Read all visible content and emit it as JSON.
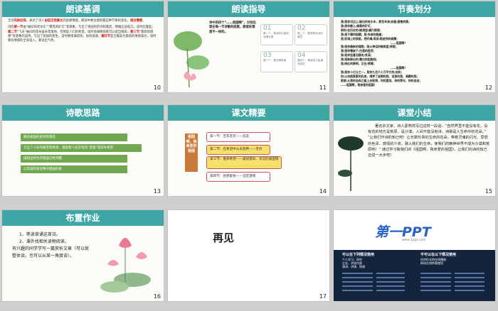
{
  "slides": [
    {
      "num": "10",
      "title": "朗读基调",
      "p1": [
        "全诗",
        "先抑后扬",
        "，表达了诗人",
        "由低沉而高亢",
        "的思想情绪，朗读中要注意把握这种节奏的变化、",
        "读出情感",
        "。"
      ],
      "p2": [
        "诗的",
        "第一节",
        "由“破旧的老水车”“熏黑的矿灯”等意象，写出了祖国的贫穷和落后，情绪应该低沉，读时应慢些；",
        "第二节",
        "“飞天”袖间的花朵虽未曾落地，但那是人们的希望，读时语调稍前者可以适当稍高；",
        "第三节",
        "“簇新的理想”等意象的运用，写出了祖国的新生，读时要饱满欢快，加快语速；",
        "第四节",
        "是全篇高亢激昂的情感表达，读时要有情感的全身投入，要读出气势。"
      ]
    },
    {
      "num": "11",
      "title": "朗读指导",
      "intro": "诗中的四个“……祖国啊”，分别出现在每一节诗歌的结尾，朗读处理是不一样的。",
      "boxes": [
        {
          "n": "01",
          "t": "第一个，要读的沉重而深情无限"
        },
        {
          "n": "02",
          "t": "第二个，要带着深深的情意"
        },
        {
          "n": "03",
          "t": "第三个，要充满希望"
        },
        {
          "n": "04",
          "t": "第四个，要保持力量满而坚定"
        }
      ]
    },
    {
      "num": "12",
      "title": "节奏划分",
      "lines": [
        "我/是你河边上/破旧的老水车，数百年来/纺着/疲惫的歌；",
        "我/是你额上/熏黑的矿灯，",
        "照你/在历史的/隧洞里/蜗行摸索；",
        "我/是干瘪的稻穗；是/失修的路基；",
        "是/淤滩上的驳船，把纤绳/深深/勒进你的肩膊；",
        "——祖国啊！",
        "我/是你簇新的理想，刚从神话的蛛网里/挣脱；",
        "我/是你雪被下/古莲的胚芽；",
        "我/是你挂着泪痕的/笑涡；",
        "我/是新刷出的/雪白的起跑线；",
        "是/绯红的黎明，正在/喷薄；",
        "——祖国啊！",
        "我/是你十亿分之一，是你九百六十万平方的/总和；",
        "你/以伤痕累累的乳房，喂养了迷惘的我、深思的我、沸腾的我；",
        "那就/从我的血肉之躯上去取得，你的富饶、你的荣光、你的自由；",
        "——祖国啊，我亲爱的祖国！"
      ]
    },
    {
      "num": "13",
      "title": "诗歌思路",
      "items": [
        "概括祖国的贫穷和落后",
        "写出了人民的痛苦和希望，祖国和人民没有因“贫困”而丧失希望",
        "描绘出新生的祖国已经觉醒",
        "以赤诚的爱诠释对祖国的爱"
      ]
    },
    {
      "num": "14",
      "title": "课文精要",
      "center": "祖国啊，我亲爱的祖国",
      "items": [
        "第一节：百年贫穷——悲哀",
        "第二节：在希望中从未放弃——无奈",
        "第三节：重获希望——喜悦激动、深沉的爱国情",
        "第四节：甘愿献身——坚定激情"
      ]
    },
    {
      "num": "15",
      "title": "课堂小结",
      "text": "著名杂文家、诗人邵燕祥写过这样一段话：“自然界里不能没有花，没有花的地方是荒原，是沙漠，人间不能没有诗，诗歌是人生命中的花朵。” “让我们作诗的知己吧！让无数珍贵的生命的花朵，带着灵魂的闪光、思想的色泽、感情的汁液，融入我们的生命，使我们的精神世界不成为沙漠和荒原吧！” 通过学习致我们的《祖国啊，我亲爱的祖国》，让我们向诗的知己迈进一大步吧！"
    },
    {
      "num": "16",
      "title": "布置作业",
      "items": [
        "1、熟读背诵这首诗。",
        "2、课外找相关读物阅读。",
        "有兴趣的同学学写一篇赏析文章（可以就整体谈，也可以从某一角度谈）。"
      ]
    },
    {
      "num": "17",
      "title": "再见"
    },
    {
      "num": "18",
      "logo": "第一PPT",
      "url": "www.1ppt.com",
      "left_title": "可以在下列情况使用",
      "right_title": "不可以在以下情况使用",
      "left_lines": [
        "个人学习、研究",
        "企业、学校内部",
        "演讲、讲课、授课"
      ],
      "right_lines": [
        "任何形式的在线播放",
        "网站在线转载使用"
      ]
    }
  ],
  "colors": {
    "header": "#3fa6a6",
    "accent_red": "#d21010",
    "green": "#6fa84e"
  }
}
